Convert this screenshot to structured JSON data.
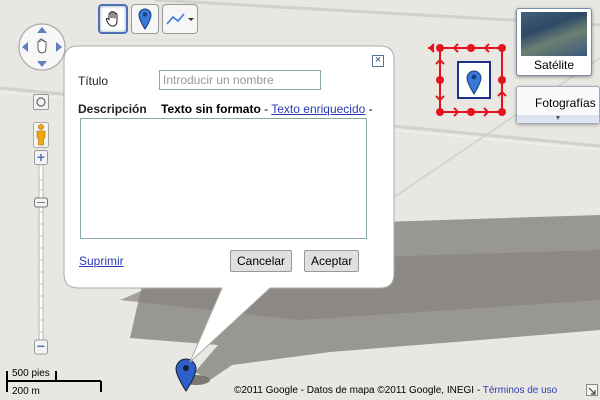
{
  "toolbar": {
    "hand_tool": "hand-icon",
    "marker_tool": "marker-icon",
    "line_tool": "line-icon"
  },
  "map_controls": {
    "zoom_in": "+",
    "zoom_out": "−"
  },
  "scale": {
    "imperial": "500 pies",
    "metric": "200 m"
  },
  "map_type": {
    "satellite_label": "Satélite",
    "photos_label": "Fotografías"
  },
  "dialog": {
    "title_label": "Título",
    "title_placeholder": "Introducir un nombre",
    "description_label": "Descripción",
    "plain_text_option": "Texto sin formato",
    "separator": " - ",
    "rich_text_option": "Texto enriquecido",
    "trailing_separator": " -",
    "delete_link": "Suprimir",
    "cancel_button": "Cancelar",
    "accept_button": "Aceptar",
    "close_icon": "×"
  },
  "footer": {
    "copyright": "©2011 Google - Datos de mapa ©2011 Google, INEGI - ",
    "terms_link": "Términos de uso"
  },
  "colors": {
    "edit_handles": "#e8121f",
    "marker_blue": "#2f5ec8",
    "link_blue": "#2a3bb6"
  }
}
